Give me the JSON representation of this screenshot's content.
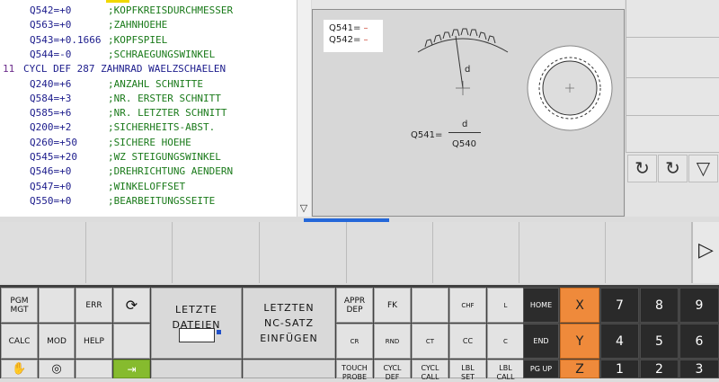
{
  "program": {
    "top_label": "...",
    "lines": [
      {
        "num": "",
        "code": "Q542=+0",
        "comment": ";KOPFKREISDURCHMESSER"
      },
      {
        "num": "",
        "code": "Q563=+0",
        "comment": ";ZAHNHOEHE"
      },
      {
        "num": "",
        "code": "Q543=+0.1666",
        "comment": ";KOPFSPIEL"
      },
      {
        "num": "",
        "code": "Q544=-0",
        "comment": ";SCHRAEGUNGSWINKEL"
      },
      {
        "num": "11",
        "code": "CYCL DEF 287 ZAHNRAD WAELZSCHAELEN",
        "comment": ""
      },
      {
        "num": "",
        "code": "Q240=+6",
        "comment": ";ANZAHL SCHNITTE"
      },
      {
        "num": "",
        "code": "Q584=+3",
        "comment": ";NR. ERSTER SCHNITT"
      },
      {
        "num": "",
        "code": "Q585=+6",
        "comment": ";NR. LETZTER SCHNITT"
      },
      {
        "num": "",
        "code": "Q200=+2",
        "comment": ";SICHERHEITS-ABST."
      },
      {
        "num": "",
        "code": "Q260=+50",
        "comment": ";SICHERE HOEHE"
      },
      {
        "num": "",
        "code": "Q545=+20",
        "comment": ";WZ STEIGUNGSWINKEL"
      },
      {
        "num": "",
        "code": "Q546=+0",
        "comment": ";DREHRICHTUNG AENDERN"
      },
      {
        "num": "",
        "code": "Q547=+0",
        "comment": ";WINKELOFFSET"
      },
      {
        "num": "",
        "code": "Q550=+0",
        "comment": ";BEARBEITUNGSSEITE"
      }
    ],
    "scroll_down_glyph": "▽"
  },
  "help": {
    "params": [
      {
        "label": "Q541=",
        "value": "–"
      },
      {
        "label": "Q542=",
        "value": "–"
      }
    ],
    "graphic_label": "d",
    "formula_lhs": "Q541=",
    "formula_num": "d",
    "formula_den": "Q540"
  },
  "right_buttons": [
    "↻",
    "↻",
    "▽"
  ],
  "softkey_next_glyph": "▷",
  "keyboard": {
    "pgm_mgt": "PGM\nMGT",
    "err": "ERR",
    "calc": "CALC",
    "mod": "MOD",
    "help": "HELP",
    "letzte_dateien": "LETZTE\nDATEIEN",
    "letzten_nc": "LETZTEN\nNC-SATZ\nEINFÜGEN",
    "appr_dep": "APPR\nDEP",
    "fk": "FK",
    "chf": "CHF",
    "l": "L",
    "cr": "CR",
    "rnd": "RND",
    "ct": "CT",
    "cc": "CC",
    "c": "C",
    "touch_probe": "TOUCH\nPROBE",
    "cycl_def": "CYCL\nDEF",
    "cycl_call": "CYCL\nCALL",
    "lbl_set": "LBL\nSET",
    "lbl_call": "LBL\nCALL",
    "home": "HOME",
    "end": "END",
    "pg_up": "PG UP",
    "x": "X",
    "y": "Y",
    "z": "Z",
    "n7": "7",
    "n8": "8",
    "n9": "9",
    "n4": "4",
    "n5": "5",
    "n6": "6",
    "n1": "1",
    "n2": "2",
    "n3": "3"
  },
  "colors": {
    "orange": "#ef8a3b",
    "keypad_dark": "#2a2a2a",
    "progress_blue": "#2467d9",
    "comment_green": "#1a7a1a",
    "code_blue": "#1c1c8c"
  }
}
